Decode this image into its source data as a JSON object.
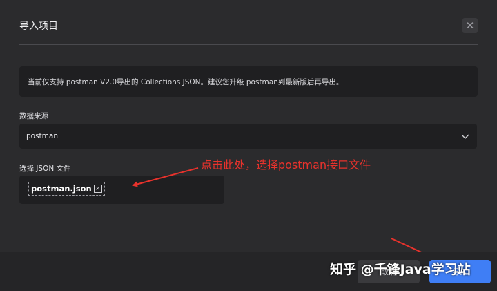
{
  "dialog": {
    "title": "导入项目",
    "close_icon": "close-icon",
    "notice": "当前仅支持 postman V2.0导出的 Collections JSON。建议您升级 postman到最新版后再导出。",
    "source_label": "数据来源",
    "source_value": "postman",
    "file_label": "选择 JSON 文件",
    "file_name": "postman.json",
    "file_remove_glyph": "×",
    "cancel_label": "取消",
    "import_label": "导入"
  },
  "annotation": {
    "text": "点击此处，选择postman接口文件",
    "color": "#e8322c"
  },
  "watermark": {
    "text": "知乎 @千锋Java学习站"
  },
  "colors": {
    "accent": "#3f7ef5",
    "background": "#2b2b2d",
    "field": "#1f1f21"
  }
}
